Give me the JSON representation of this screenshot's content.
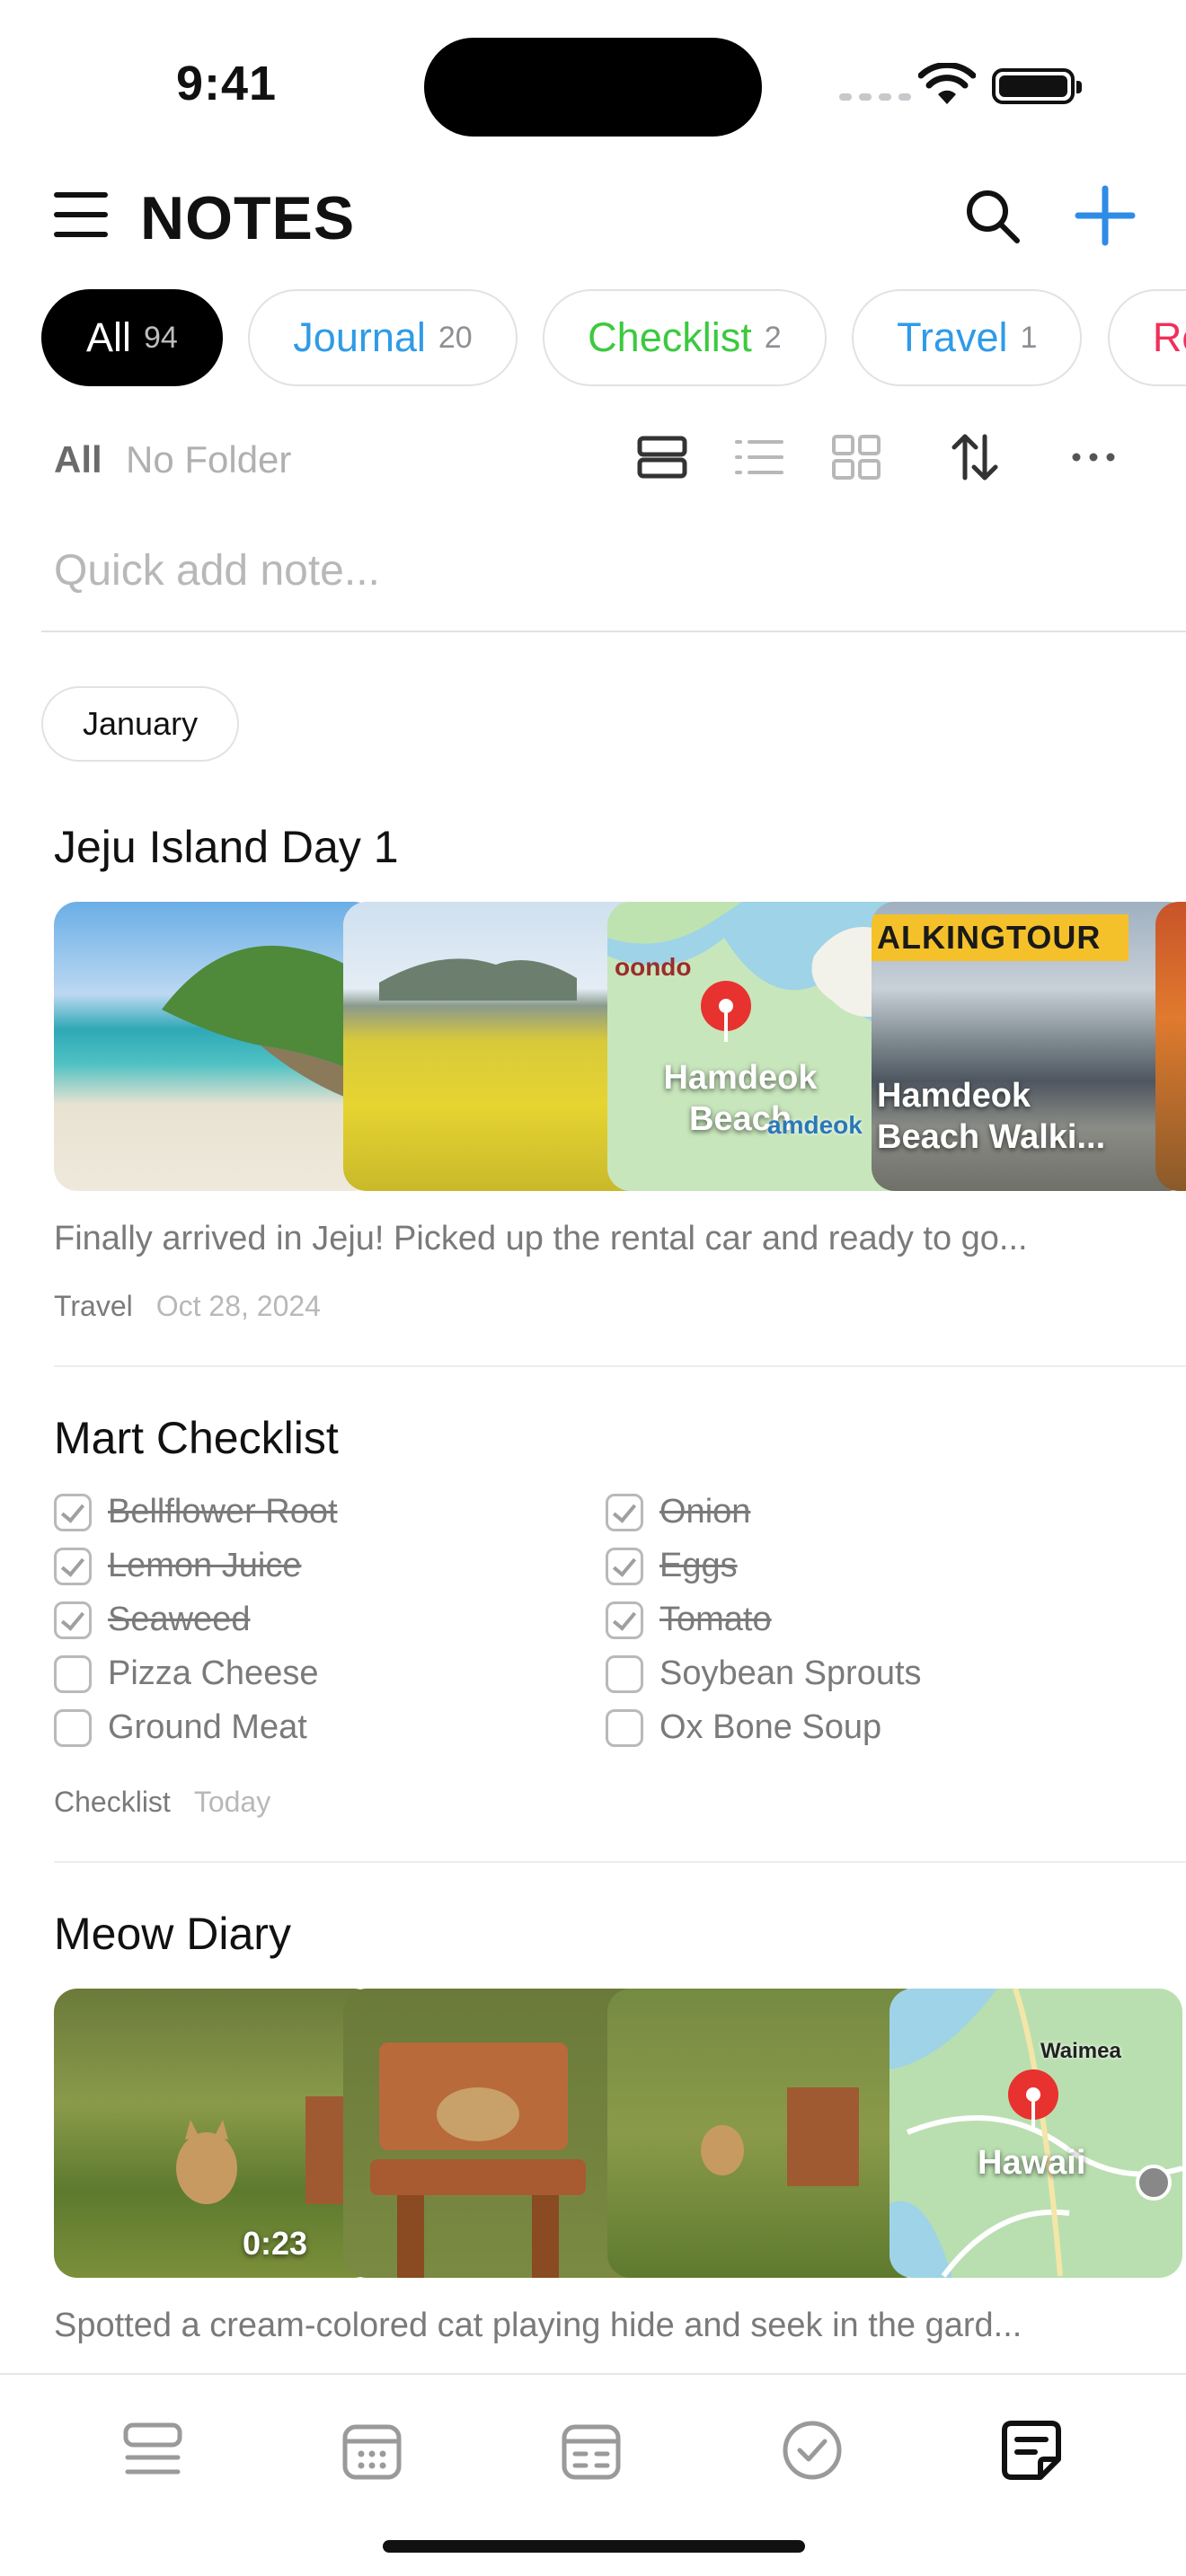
{
  "status": {
    "time": "9:41"
  },
  "header": {
    "title": "NOTES"
  },
  "chips": [
    {
      "label": "All",
      "count": "94",
      "color": "#ffffff"
    },
    {
      "label": "Journal",
      "count": "20",
      "color": "#2f9be8"
    },
    {
      "label": "Checklist",
      "count": "2",
      "color": "#3cc93f"
    },
    {
      "label": "Travel",
      "count": "1",
      "color": "#2f9be8"
    },
    {
      "label": "Rec",
      "count": "",
      "color": "#f0305a"
    }
  ],
  "filter": {
    "all": "All",
    "folder": "No Folder"
  },
  "quick_add": {
    "placeholder": "Quick add note..."
  },
  "month": "January",
  "notes": [
    {
      "title": "Jeju Island Day 1",
      "media": {
        "map_place": "oondo",
        "map_label": "Hamdeok Beach",
        "map_sub": "amdeok",
        "video_banner": "ALKINGTOUR",
        "video_label": "Hamdeok Beach Walki..."
      },
      "snippet": "Finally arrived in Jeju! Picked up the rental car and ready to go...",
      "category": "Travel",
      "date": "Oct 28, 2024"
    },
    {
      "title": "Mart Checklist",
      "items_left": [
        {
          "label": "Bellflower Root",
          "checked": true
        },
        {
          "label": "Lemon Juice",
          "checked": true
        },
        {
          "label": "Seaweed",
          "checked": true
        },
        {
          "label": "Pizza Cheese",
          "checked": false
        },
        {
          "label": "Ground Meat",
          "checked": false
        }
      ],
      "items_right": [
        {
          "label": "Onion",
          "checked": true
        },
        {
          "label": "Eggs",
          "checked": true
        },
        {
          "label": "Tomato",
          "checked": true
        },
        {
          "label": "Soybean Sprouts",
          "checked": false
        },
        {
          "label": "Ox Bone Soup",
          "checked": false
        }
      ],
      "category": "Checklist",
      "date": "Today"
    },
    {
      "title": "Meow Diary",
      "media": {
        "video_duration": "0:23",
        "map_place": "Waimea",
        "map_label": "Hawaii"
      },
      "snippet": "Spotted a cream-colored cat playing hide and seek in the gard..."
    }
  ],
  "tabbar": [
    "list-tab-icon",
    "calendar-tab-icon",
    "board-tab-icon",
    "checklist-tab-icon",
    "notes-tab-icon"
  ],
  "colors": {
    "accent": "#2f8ce6",
    "checklist": "#3cc93f",
    "pin": "#e8322f"
  }
}
